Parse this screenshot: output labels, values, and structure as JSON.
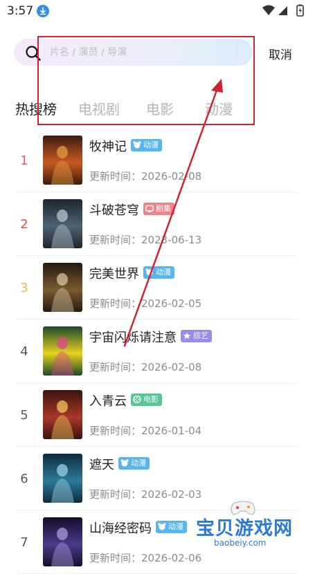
{
  "status_bar": {
    "time": "3:57"
  },
  "search": {
    "placeholder": "片名 / 演员 / 导演",
    "value": "",
    "cancel_label": "取消"
  },
  "tabs": [
    {
      "label": "热搜榜",
      "active": true
    },
    {
      "label": "电视剧",
      "active": false
    },
    {
      "label": "电影",
      "active": false
    },
    {
      "label": "动漫",
      "active": false
    }
  ],
  "rankings": [
    {
      "rank": "1",
      "rank_color": "#e0578a",
      "title": "牧神记",
      "category": "动漫",
      "badge_color": "#57b5f0",
      "badge_icon": "cartoon-icon",
      "update_label": "更新时间：",
      "date": "2026-02-08",
      "poster_colors": [
        "#3a1c10",
        "#c85a22",
        "#e89c3c"
      ]
    },
    {
      "rank": "2",
      "rank_color": "#e04e3c",
      "title": "斗破苍穹",
      "category": "剧集",
      "badge_color": "#f0838a",
      "badge_icon": "tv-icon",
      "update_label": "更新时间：",
      "date": "2023-06-13",
      "poster_colors": [
        "#1c2630",
        "#4e6272",
        "#b8c4cc"
      ]
    },
    {
      "rank": "3",
      "rank_color": "#e8b84a",
      "title": "完美世界",
      "category": "动漫",
      "badge_color": "#57b5f0",
      "badge_icon": "cartoon-icon",
      "update_label": "更新时间：",
      "date": "2026-02-05",
      "poster_colors": [
        "#241a10",
        "#7a5a30",
        "#d8c4a0"
      ]
    },
    {
      "rank": "4",
      "rank_color": "#555555",
      "title": "宇宙闪烁请注意",
      "category": "综艺",
      "badge_color": "#9b8af0",
      "badge_icon": "star-icon",
      "update_label": "更新时间：",
      "date": "2026-02-08",
      "poster_colors": [
        "#1a4a2a",
        "#e8d020",
        "#d84a8a"
      ]
    },
    {
      "rank": "5",
      "rank_color": "#555555",
      "title": "入青云",
      "category": "电影",
      "badge_color": "#56c796",
      "badge_icon": "film-icon",
      "update_label": "更新时间：",
      "date": "2026-01-04",
      "poster_colors": [
        "#3a140c",
        "#a8382a",
        "#f0c860"
      ]
    },
    {
      "rank": "6",
      "rank_color": "#555555",
      "title": "遮天",
      "category": "动漫",
      "badge_color": "#57b5f0",
      "badge_icon": "cartoon-icon",
      "update_label": "更新时间：",
      "date": "2026-02-03",
      "poster_colors": [
        "#0c2a3c",
        "#2e7a9a",
        "#9ad0e0"
      ]
    },
    {
      "rank": "7",
      "rank_color": "#555555",
      "title": "山海经密码",
      "category": "动漫",
      "badge_color": "#57b5f0",
      "badge_icon": "cartoon-icon",
      "update_label": "更新时间：",
      "date": "2026-02-06",
      "poster_colors": [
        "#180c2a",
        "#4a3a8a",
        "#a89ae0"
      ]
    }
  ],
  "annotation": {
    "color": "#d0212f"
  },
  "watermark": {
    "brand": "宝贝游戏网",
    "url": "baobeiy.com"
  }
}
